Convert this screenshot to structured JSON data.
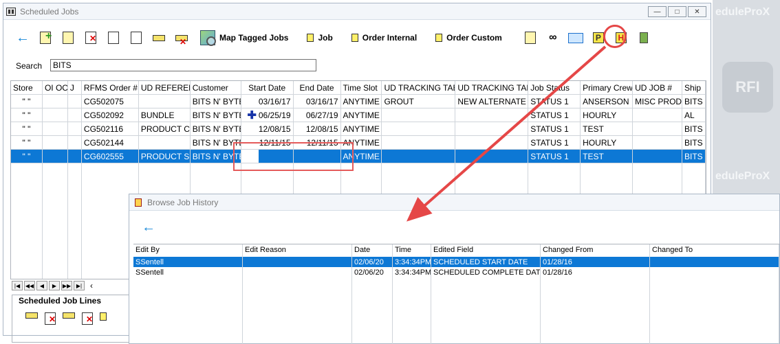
{
  "window": {
    "title": "Scheduled Jobs",
    "controls": [
      "—",
      "□",
      "✕"
    ]
  },
  "toolbar": {
    "map_tagged": "Map Tagged Jobs",
    "job": "Job",
    "order_internal": "Order Internal",
    "order_custom": "Order Custom",
    "history_icon_text": "H",
    "p_icon_text": "P"
  },
  "search": {
    "label": "Search",
    "value": "BITS"
  },
  "grid": {
    "columns": [
      "Store",
      "OI OC",
      "J",
      "RFMS Order #",
      "UD REFERENC",
      "Customer",
      "Start Date",
      "End Date",
      "Time Slot",
      "UD TRACKING TABL",
      "UD TRACKING TABL",
      "Job Status",
      "Primary Crew",
      "UD JOB #",
      "Ship"
    ],
    "rows": [
      [
        "\" \"",
        "",
        "",
        "CG502075",
        "",
        "BITS N' BYTES",
        "03/16/17",
        "03/16/17",
        "ANYTIME",
        "GROUT",
        "NEW ALTERNATE",
        "STATUS 1",
        "ANSERSON",
        "MISC PRODU",
        "BITS"
      ],
      [
        "\" \"",
        "",
        "",
        "CG502092",
        "BUNDLE",
        "BITS N' BYTES",
        "06/25/19",
        "06/27/19",
        "ANYTIME",
        "",
        "",
        "STATUS 1",
        "HOURLY",
        "",
        "AL"
      ],
      [
        "\" \"",
        "",
        "",
        "CG502116",
        "PRODUCT CO",
        "BITS N' BYTES",
        "12/08/15",
        "12/08/15",
        "ANYTIME",
        "",
        "",
        "STATUS 1",
        "TEST",
        "",
        "BITS"
      ],
      [
        "\" \"",
        "",
        "",
        "CG502144",
        "",
        "BITS N' BYTES",
        "12/11/15",
        "12/11/15",
        "ANYTIME",
        "",
        "",
        "STATUS 1",
        "HOURLY",
        "",
        "BITS"
      ],
      [
        "\" \"",
        "",
        "",
        "CG602555",
        "PRODUCT SEA",
        "BITS N' BYTES",
        "",
        "",
        "ANYTIME",
        "",
        "",
        "STATUS 1",
        "TEST",
        "",
        "BITS"
      ]
    ]
  },
  "lines": {
    "title": "Scheduled Job Lines"
  },
  "history": {
    "title": "Browse Job History",
    "columns": [
      "Edit By",
      "Edit Reason",
      "Date",
      "Time",
      "Edited Field",
      "Changed From",
      "Changed To"
    ],
    "rows": [
      [
        "SSentell",
        "",
        "02/06/20",
        "3:34:34PM",
        "SCHEDULED START DATE",
        "01/28/16",
        ""
      ],
      [
        "SSentell",
        "",
        "02/06/20",
        "3:34:34PM",
        "SCHEDULED COMPLETE DATE",
        "01/28/16",
        ""
      ]
    ]
  },
  "background": {
    "watermark": "eduleProX",
    "rfi": "RFI"
  }
}
